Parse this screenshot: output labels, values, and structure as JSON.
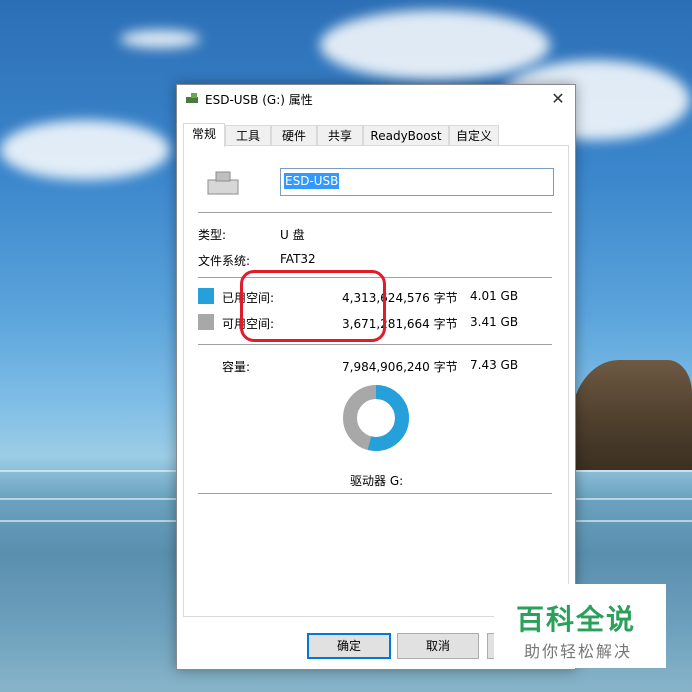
{
  "window": {
    "title": "ESD-USB (G:) 属性",
    "close_glyph": "✕",
    "title_icon": "usb-drive-icon"
  },
  "tabs": [
    {
      "label": "常规",
      "active": true
    },
    {
      "label": "工具"
    },
    {
      "label": "硬件"
    },
    {
      "label": "共享"
    },
    {
      "label": "ReadyBoost"
    },
    {
      "label": "自定义"
    }
  ],
  "general": {
    "drive_name": "ESD-USB",
    "type_label": "类型:",
    "type_value": "U 盘",
    "fs_label": "文件系统:",
    "fs_value": "FAT32",
    "used_label": "已用空间:",
    "used_bytes": "4,313,624,576 字节",
    "used_gb": "4.01 GB",
    "free_label": "可用空间:",
    "free_bytes": "3,671,281,664 字节",
    "free_gb": "3.41 GB",
    "capacity_label": "容量:",
    "capacity_bytes": "7,984,906,240 字节",
    "capacity_gb": "7.43 GB",
    "drive_label": "驱动器 G:",
    "used_fraction": 0.54
  },
  "colors": {
    "used": "#26a0da",
    "free": "#a8a8a8",
    "annotation": "#e01c2a"
  },
  "buttons": {
    "ok": "确定",
    "cancel": "取消"
  },
  "watermark": {
    "main": "百科全说",
    "sub": "助你轻松解决"
  }
}
